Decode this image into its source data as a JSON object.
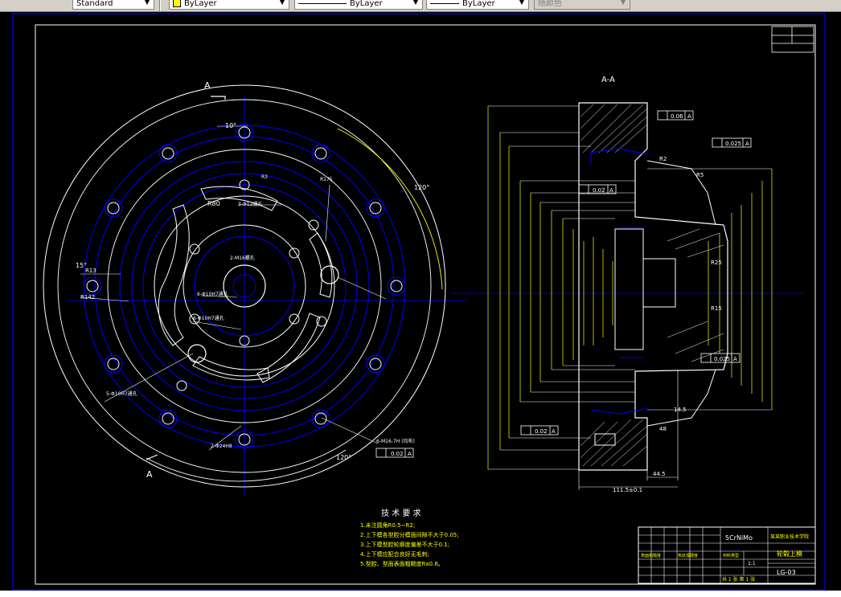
{
  "toolbar": {
    "textstyle": "Standard",
    "layer": "ByLayer",
    "linetype": "ByLayer",
    "lineweight": "ByLayer",
    "plotstyle": "随颜色"
  },
  "view": {
    "section_label": "A-A",
    "section_mark": "A"
  },
  "dims": {
    "angle_10": "10°",
    "angle_120_top": "120°",
    "angle_120_bottom": "120°",
    "angle_15": "15°",
    "r80": "R80",
    "r3": "R3",
    "r175": "R175",
    "r13": "R13",
    "r142": "R142",
    "r2": "R2",
    "r5": "R5",
    "r25": "R25",
    "r15": "R15",
    "holes_3": "3-Φ12通孔",
    "holes_2m16": "2-M16螺孔",
    "holes_6": "6-Φ10H7通孔",
    "holes_6b": "6-Φ10H7通孔",
    "holes_5": "5-Φ10H7通孔",
    "holes_2_24": "2-Φ24H8",
    "holes_6m16": "6-M16-7H (均布)",
    "tol_002": "0.02",
    "tol_002_b": "0.02",
    "tol_006": "0.06",
    "tol_0025": "0.025",
    "tol_0025_b": "0.025",
    "dim_1115": "111.5±0.1",
    "dim_445": "44.5",
    "dim_145": "14.5",
    "dim_48": "48",
    "datum": "A"
  },
  "tech": {
    "title": "技 术 要 求",
    "lines": [
      "1.未注圆角R0.5~R2;",
      "2.上下模各型腔分模面间隙不大于0.05;",
      "3.上下模型腔轮廓度偏差不大于0.1;",
      "4.上下模应配合良好无毛刺;",
      "5.型腔、型面表面粗糙度Ra0.8。"
    ]
  },
  "rough": {
    "label1": "表面粗糙度",
    "label2": "热处理硬度",
    "label3": "材料类型"
  },
  "titleblock": {
    "material": "5CrNiMo",
    "school": "某某职业技术学院",
    "part_name": "轮毂上模",
    "drawing_no": "LG-03",
    "scale": "1:1",
    "sheets": "共 1 张   第 1 张"
  },
  "colors": {
    "bg": "#000000",
    "border": "#0000ff",
    "yellow": "#ffff00",
    "white": "#ffffff",
    "cyan": "#00ffff",
    "green": "#00ff00",
    "red": "#ff0000"
  }
}
